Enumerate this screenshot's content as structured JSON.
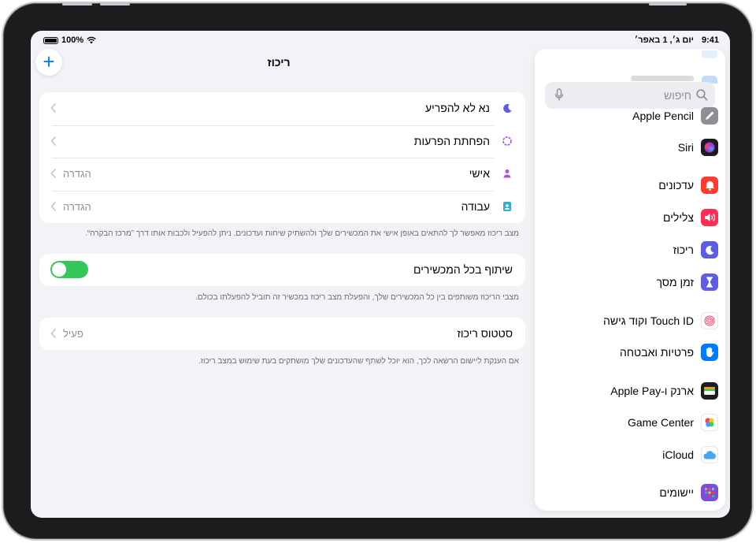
{
  "status_bar": {
    "time": "9:41",
    "date": "יום ג׳, 1 באפר׳",
    "battery": "100%"
  },
  "main": {
    "title": "ריכוז",
    "add_label": "+",
    "modes": [
      {
        "label": "נא לא להפריע",
        "value": "",
        "icon": "moon-icon",
        "color": "#5e5ce6"
      },
      {
        "label": "הפחתת הפרעות",
        "value": "",
        "icon": "flower-icon",
        "color": "#af52de"
      },
      {
        "label": "אישי",
        "value": "הגדרה",
        "icon": "person-icon",
        "color": "#af52de"
      },
      {
        "label": "עבודה",
        "value": "הגדרה",
        "icon": "badge-icon",
        "color": "#30b0c7"
      }
    ],
    "modes_footnote": "מצב ריכוז מאפשר לך להתאים באופן אישי את המכשירים שלך ולהשתיק שיחות ועדכונים. ניתן להפעיל ולכבות אותו דרך ”מרכז הבקרה“.",
    "share": {
      "label": "שיתוף בכל המכשירים",
      "on": true
    },
    "share_footnote": "מצבי הריכוז משותפים בין כל המכשירים שלך, והפעלת מצב ריכוז במכשיר זה תוביל להפעלתו בכולם.",
    "status": {
      "label": "סטטוס ריכוז",
      "value": "פעיל"
    },
    "status_footnote": "אם הענקת ליישום הרשאה לכך, הוא יוכל לשתף שהעדכונים שלך מושתקים בעת שימוש במצב ריכוז."
  },
  "sidebar": {
    "search_placeholder": "חיפוש",
    "items": [
      {
        "label": "Apple Pencil",
        "icon": "pencil-icon",
        "color": "#8e8e93"
      },
      {
        "label": "Siri",
        "icon": "siri-icon",
        "color": "#1c1c1e"
      },
      {
        "label": "עדכונים",
        "icon": "bell-icon",
        "color": "#ff3b30"
      },
      {
        "label": "צלילים",
        "icon": "speaker-icon",
        "color": "#ff2d55"
      },
      {
        "label": "ריכוז",
        "icon": "moon-icon",
        "color": "#5e5ce6"
      },
      {
        "label": "זמן מסך",
        "icon": "hourglass-icon",
        "color": "#5e5ce6"
      },
      {
        "label": "Touch ID וקוד גישה",
        "icon": "fingerprint-icon",
        "color": "#ffffff"
      },
      {
        "label": "פרטיות ואבטחה",
        "icon": "hand-icon",
        "color": "#007aff"
      },
      {
        "label": "ארנק ו-Apple Pay",
        "icon": "wallet-icon",
        "color": "#1c1c1e"
      },
      {
        "label": "Game Center",
        "icon": "game-center-icon",
        "color": "#ffffff"
      },
      {
        "label": "iCloud",
        "icon": "cloud-icon",
        "color": "#ffffff"
      },
      {
        "label": "יישומים",
        "icon": "apps-grid-icon",
        "color": "#7d4cdb"
      }
    ]
  }
}
